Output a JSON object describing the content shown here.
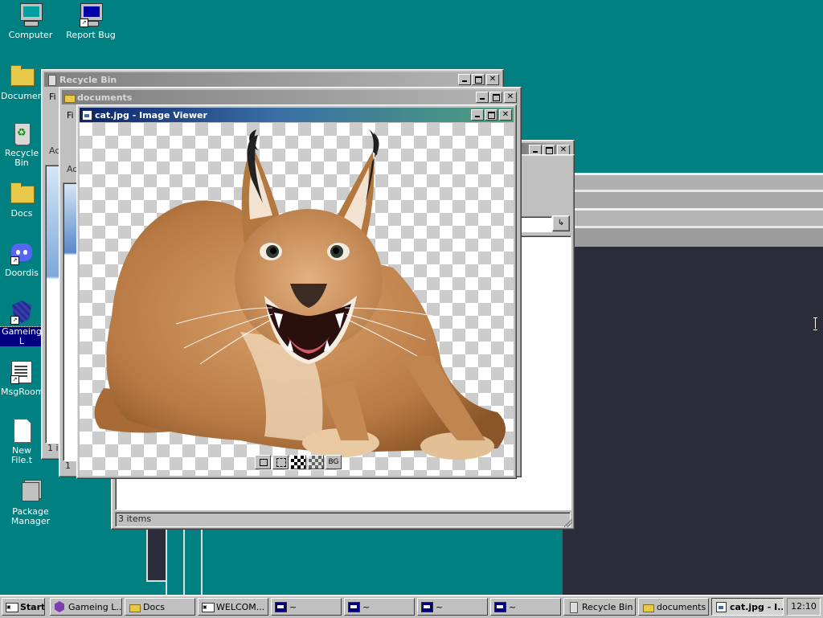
{
  "desktop": {
    "icons": [
      {
        "label": "Computer"
      },
      {
        "label": "Report Bug"
      },
      {
        "label": "Documents"
      },
      {
        "label": "Recycle Bin"
      },
      {
        "label": "Docs"
      },
      {
        "label": "Doordis"
      },
      {
        "label": "Gameing L"
      },
      {
        "label": "MsgRoom"
      },
      {
        "label": "New File.t"
      },
      {
        "label": "Package Manager"
      }
    ]
  },
  "windows": {
    "recycle_bin": {
      "title": "Recycle Bin",
      "menu_partial": "Fi",
      "addr_partial": "Ac",
      "status": "1 ite"
    },
    "documents": {
      "title": "documents",
      "menu_partial": "Fi",
      "addr_partial": "Ad",
      "status": "1 ite"
    },
    "docs": {
      "status": "3 items"
    },
    "image_viewer": {
      "title": "cat.jpg - Image Viewer",
      "toolbar": {
        "bg_label": "BG"
      }
    }
  },
  "taskbar": {
    "start_label": "Start",
    "buttons": [
      {
        "label": "Gameing L..."
      },
      {
        "label": "Docs"
      },
      {
        "label": "WELCOM..."
      },
      {
        "label": "~"
      },
      {
        "label": "~"
      },
      {
        "label": "~"
      },
      {
        "label": "~"
      },
      {
        "label": "Recycle Bin"
      },
      {
        "label": "documents"
      },
      {
        "label": "cat.jpg - I..."
      }
    ],
    "clock": "12:10"
  },
  "colors": {
    "desktop": "#008080",
    "dark_panel": "#2b2d3a",
    "title_active_start": "#0a246a",
    "title_active_end": "#4ca07a"
  }
}
